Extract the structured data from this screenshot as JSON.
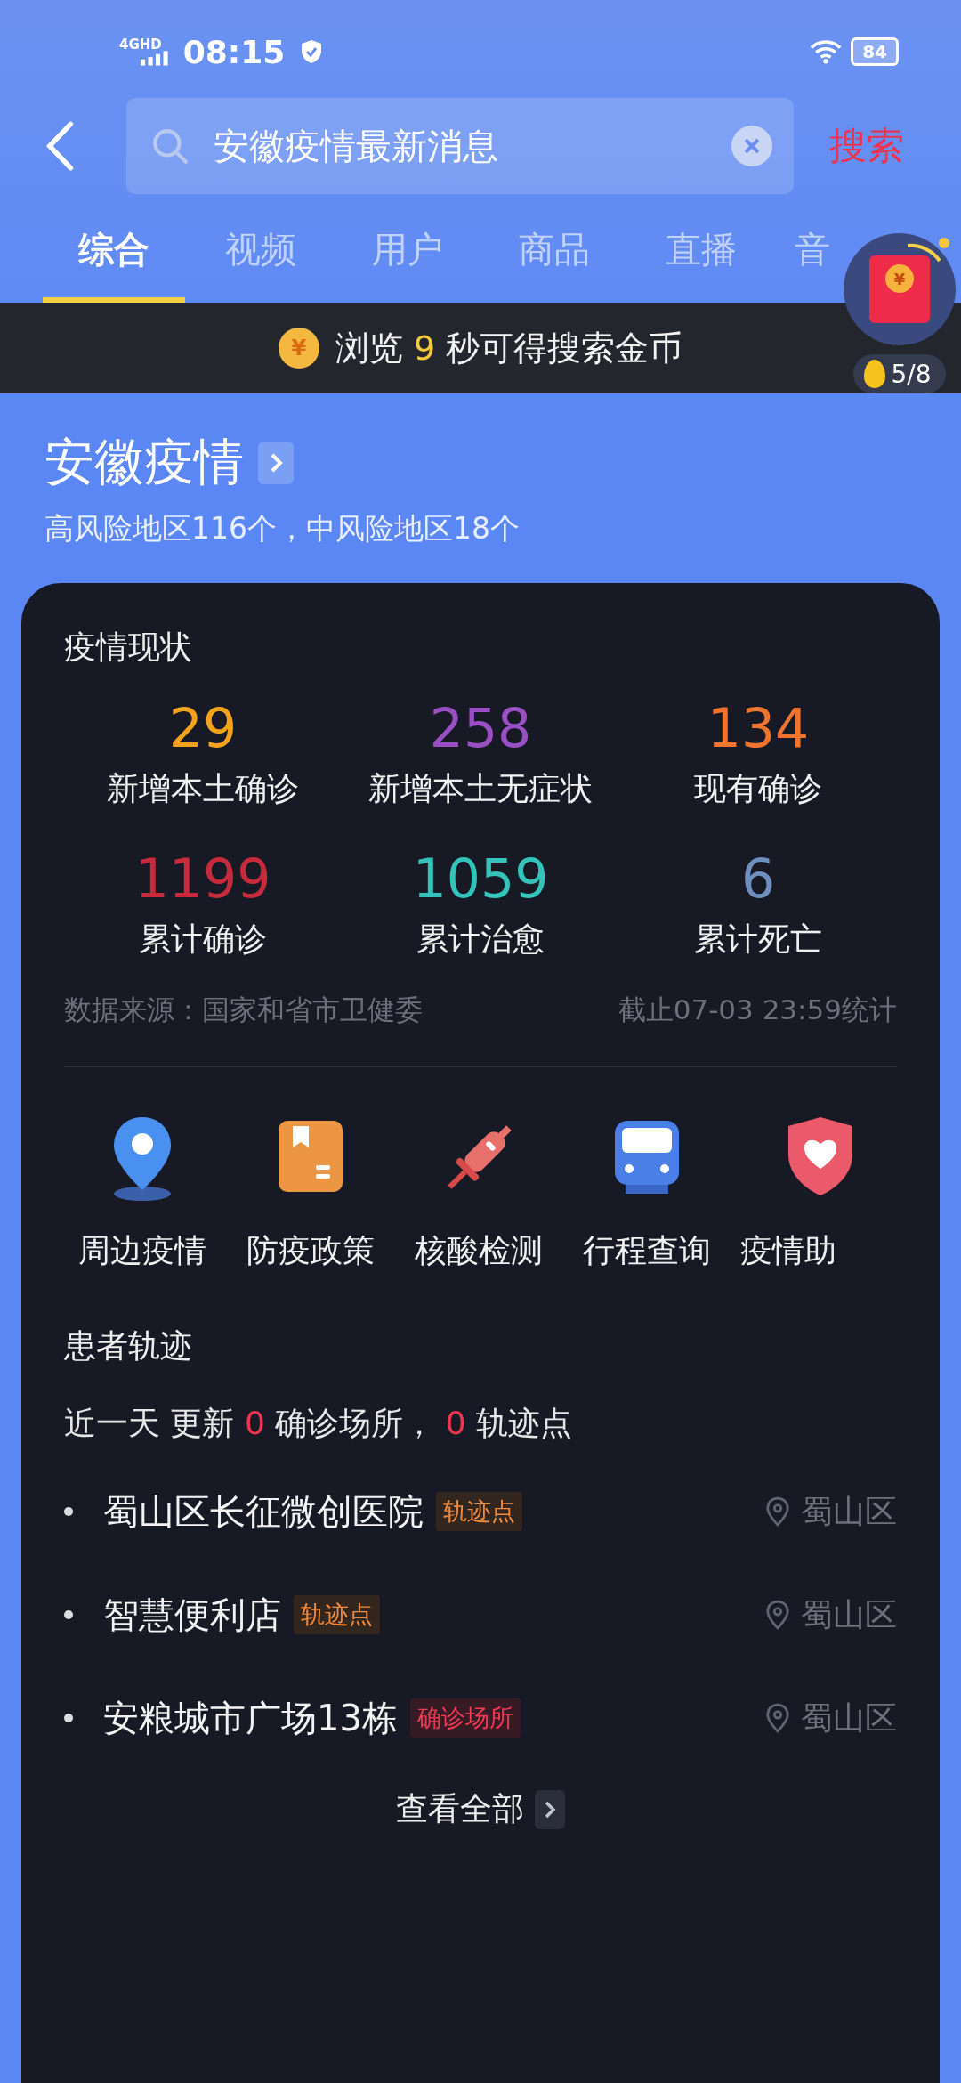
{
  "status_bar": {
    "network": "4GHD",
    "time": "08:15",
    "battery": "84"
  },
  "search": {
    "value": "安徽疫情最新消息",
    "submit": "搜索"
  },
  "tabs": [
    {
      "label": "综合",
      "selected": true
    },
    {
      "label": "视频",
      "selected": false
    },
    {
      "label": "用户",
      "selected": false
    },
    {
      "label": "商品",
      "selected": false
    },
    {
      "label": "直播",
      "selected": false
    },
    {
      "label": "音",
      "selected": false
    }
  ],
  "reward_banner": {
    "coin_symbol": "¥",
    "prefix": "浏览",
    "seconds": "9",
    "suffix": "秒可得搜索金币"
  },
  "red_packet": {
    "symbol": "¥",
    "progress": "5/8"
  },
  "region": {
    "title": "安徽疫情",
    "subtitle": "高风险地区116个，中风险地区18个"
  },
  "status_card": {
    "title": "疫情现状",
    "stats": [
      {
        "value": "29",
        "label": "新增本土确诊",
        "color": "#f2a21c"
      },
      {
        "value": "258",
        "label": "新增本土无症状",
        "color": "#9a4fc4"
      },
      {
        "value": "134",
        "label": "现有确诊",
        "color": "#f0742e"
      },
      {
        "value": "1199",
        "label": "累计确诊",
        "color": "#c72a3c"
      },
      {
        "value": "1059",
        "label": "累计治愈",
        "color": "#33c3ba"
      },
      {
        "value": "6",
        "label": "累计死亡",
        "color": "#6f8fbe"
      }
    ],
    "source": "数据来源：国家和省市卫健委",
    "updated": "截止07-03 23:59统计"
  },
  "shortcuts": [
    {
      "kind": "pin",
      "label": "周边疫情"
    },
    {
      "kind": "document",
      "label": "防疫政策"
    },
    {
      "kind": "syringe",
      "label": "核酸检测"
    },
    {
      "kind": "train",
      "label": "行程查询"
    },
    {
      "kind": "shield",
      "label": "疫情助"
    }
  ],
  "trajectory": {
    "title": "患者轨迹",
    "summary": {
      "period": "近一天 更新",
      "places_count": "0",
      "places_label": "确诊场所，",
      "points_count": "0",
      "points_label": "轨迹点"
    },
    "items": [
      {
        "name": "蜀山区长征微创医院",
        "tag": "轨迹点",
        "kind": "trace",
        "district": "蜀山区"
      },
      {
        "name": "智慧便利店",
        "tag": "轨迹点",
        "kind": "trace",
        "district": "蜀山区"
      },
      {
        "name": "安粮城市广场13栋",
        "tag": "确诊场所",
        "kind": "confirmed",
        "district": "蜀山区"
      }
    ],
    "more": "查看全部"
  }
}
